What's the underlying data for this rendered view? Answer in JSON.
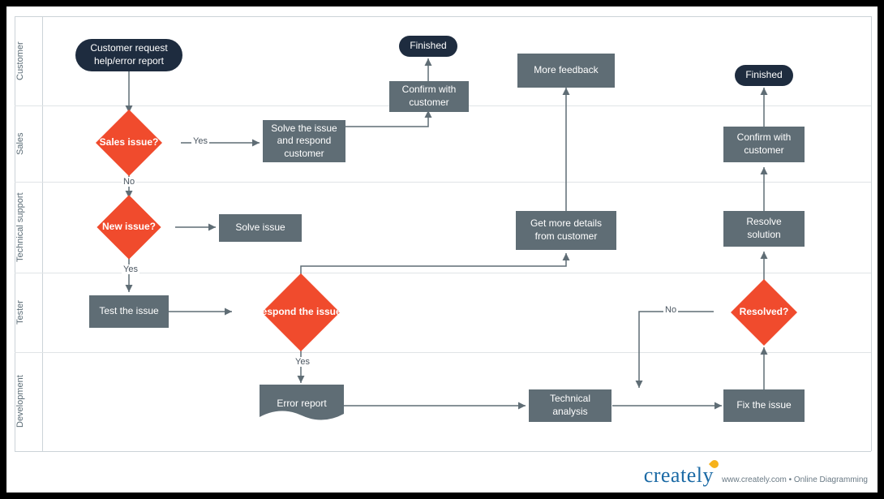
{
  "lanes": {
    "customer": "Customer",
    "sales": "Sales",
    "tech_support": "Technical support",
    "tester": "Tester",
    "development": "Development"
  },
  "nodes": {
    "start": "Customer request help/error report",
    "finished1": "Finished",
    "finished2": "Finished",
    "more_feedback": "More feedback",
    "confirm1": "Confirm with customer",
    "confirm2": "Confirm with customer",
    "sales_issue": "Sales issue?",
    "solve_respond": "Solve the issue and respond customer",
    "new_issue": "New issue?",
    "solve_issue": "Solve issue",
    "get_details": "Get more details from customer",
    "resolve_solution": "Resolve solution",
    "test_issue": "Test the issue",
    "respond_issue": "Respond the issue?",
    "resolved": "Resolved?",
    "error_report": "Error report",
    "tech_analysis": "Technical analysis",
    "fix_issue": "Fix the issue"
  },
  "edge_labels": {
    "yes": "Yes",
    "no": "No"
  },
  "footer": {
    "logo": "creately",
    "tagline": "www.creately.com • Online Diagramming"
  }
}
